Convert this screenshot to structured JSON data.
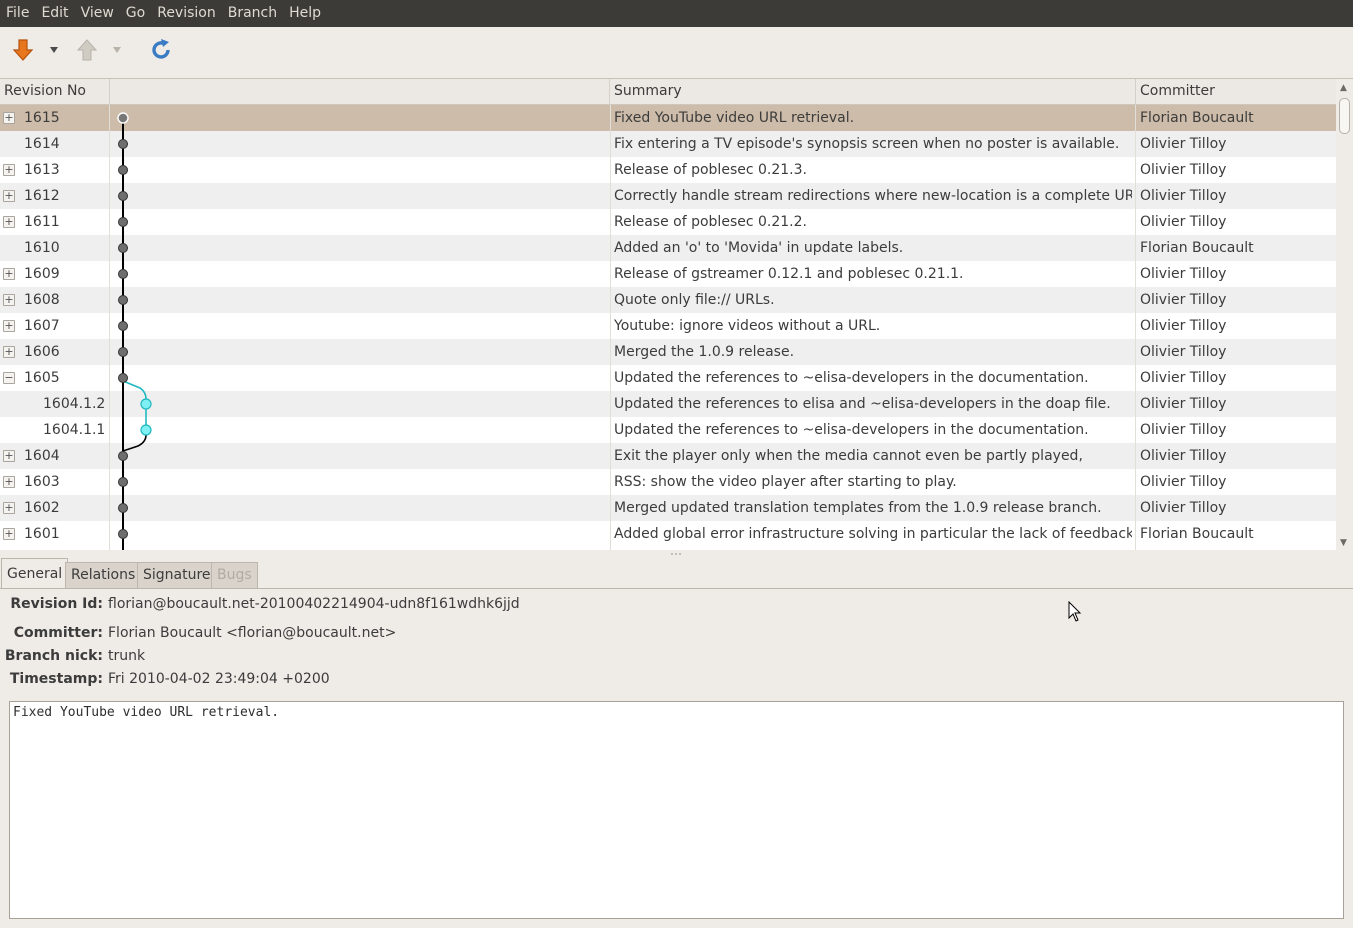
{
  "menubar": [
    "File",
    "Edit",
    "View",
    "Go",
    "Revision",
    "Branch",
    "Help"
  ],
  "toolbar": {
    "icons": [
      "pull-icon",
      "pull-dropdown-icon",
      "push-icon",
      "push-dropdown-icon",
      "refresh-icon"
    ],
    "colors": {
      "pull": "#e8761e",
      "refresh": "#3a7cc4",
      "push_disabled": "#c8c3bb"
    }
  },
  "table": {
    "headers": {
      "revno": "Revision No",
      "summary": "Summary",
      "committer": "Committer"
    },
    "rows": [
      {
        "revno": "1615",
        "expander": "+",
        "summary": "Fixed YouTube video URL retrieval.",
        "committer": "Florian Boucault",
        "selected": true
      },
      {
        "revno": "1614",
        "expander": "",
        "summary": "Fix entering a TV episode's synopsis screen when no poster is available.",
        "committer": "Olivier Tilloy"
      },
      {
        "revno": "1613",
        "expander": "+",
        "summary": "Release of poblesec 0.21.3.",
        "committer": "Olivier Tilloy"
      },
      {
        "revno": "1612",
        "expander": "+",
        "summary": "Correctly handle stream redirections where new-location is a complete URI.",
        "committer": "Olivier Tilloy"
      },
      {
        "revno": "1611",
        "expander": "+",
        "summary": "Release of poblesec 0.21.2.",
        "committer": "Olivier Tilloy"
      },
      {
        "revno": "1610",
        "expander": "",
        "summary": "Added an 'o' to 'Movida' in update labels.",
        "committer": "Florian Boucault"
      },
      {
        "revno": "1609",
        "expander": "+",
        "summary": "Release of gstreamer 0.12.1 and poblesec 0.21.1.",
        "committer": "Olivier Tilloy"
      },
      {
        "revno": "1608",
        "expander": "+",
        "summary": "Quote only file:// URLs.",
        "committer": "Olivier Tilloy"
      },
      {
        "revno": "1607",
        "expander": "+",
        "summary": "Youtube: ignore videos without a URL.",
        "committer": "Olivier Tilloy"
      },
      {
        "revno": "1606",
        "expander": "+",
        "summary": "Merged the 1.0.9 release.",
        "committer": "Olivier Tilloy"
      },
      {
        "revno": "1605",
        "expander": "−",
        "summary": "Updated the references to ~elisa-developers in the documentation.",
        "committer": "Olivier Tilloy"
      },
      {
        "revno": "1604.1.2",
        "expander": "",
        "summary": "Updated the references to elisa and ~elisa-developers in the doap file.",
        "committer": "Olivier Tilloy",
        "nested": true
      },
      {
        "revno": "1604.1.1",
        "expander": "",
        "summary": "Updated the references to ~elisa-developers in the documentation.",
        "committer": "Olivier Tilloy",
        "nested": true
      },
      {
        "revno": "1604",
        "expander": "+",
        "summary": "Exit the player only when the media cannot even be partly played,",
        "committer": "Olivier Tilloy"
      },
      {
        "revno": "1603",
        "expander": "+",
        "summary": "RSS: show the video player after starting to play.",
        "committer": "Olivier Tilloy"
      },
      {
        "revno": "1602",
        "expander": "+",
        "summary": "Merged updated translation templates from the 1.0.9 release branch.",
        "committer": "Olivier Tilloy"
      },
      {
        "revno": "1601",
        "expander": "+",
        "summary": "Added global error infrastructure solving in particular the lack of feedback",
        "committer": "Florian Boucault"
      }
    ],
    "colors": {
      "mainline": "#000000",
      "node": "#6e6e6e",
      "branchline": "#20b8c0",
      "branchnode": "#7ef0f4"
    }
  },
  "tabs": [
    {
      "label": "General",
      "active": true
    },
    {
      "label": "Relations"
    },
    {
      "label": "Signature"
    },
    {
      "label": "Bugs",
      "disabled": true
    }
  ],
  "details": {
    "revision_id_label": "Revision Id:",
    "revision_id": "florian@boucault.net-20100402214904-udn8f161wdhk6jjd",
    "committer_label": "Committer:",
    "committer": "Florian Boucault <florian@boucault.net>",
    "branch_nick_label": "Branch nick:",
    "branch_nick": "trunk",
    "timestamp_label": "Timestamp:",
    "timestamp": "Fri 2010-04-02 23:49:04 +0200",
    "message": "Fixed YouTube video URL retrieval."
  }
}
